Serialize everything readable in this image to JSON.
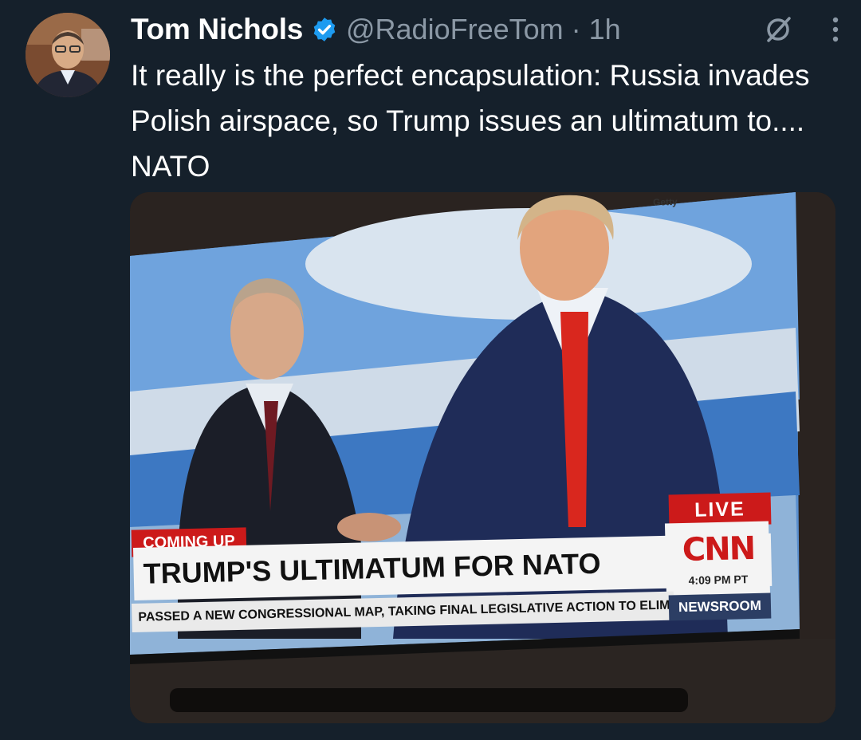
{
  "author": {
    "name": "Tom Nichols",
    "handle": "@RadioFreeTom",
    "time": "· 1h"
  },
  "tweet": {
    "text": "It really is the perfect encapsulation: Russia invades Polish airspace, so Trump issues an ultimatum to.... NATO"
  },
  "media": {
    "watermark": "Getty",
    "badge_coming_up": "COMING UP",
    "headline": "TRUMP'S ULTIMATUM FOR NATO",
    "live": "LIVE",
    "network": "CNN",
    "clock": "4:09 PM PT",
    "ticker": "PASSED A NEW CONGRESSIONAL MAP, TAKING FINAL LEGISLATIVE ACTION TO ELIMI",
    "program": "NEWSROOM"
  },
  "icons": {
    "verified": "verified-badge-icon",
    "grok": "grok-icon",
    "more": "more-options-icon"
  },
  "colors": {
    "background": "#15202b",
    "verified": "#1d9bf0",
    "muted_text": "#8b98a5",
    "cnn_red": "#cc1a1a"
  }
}
